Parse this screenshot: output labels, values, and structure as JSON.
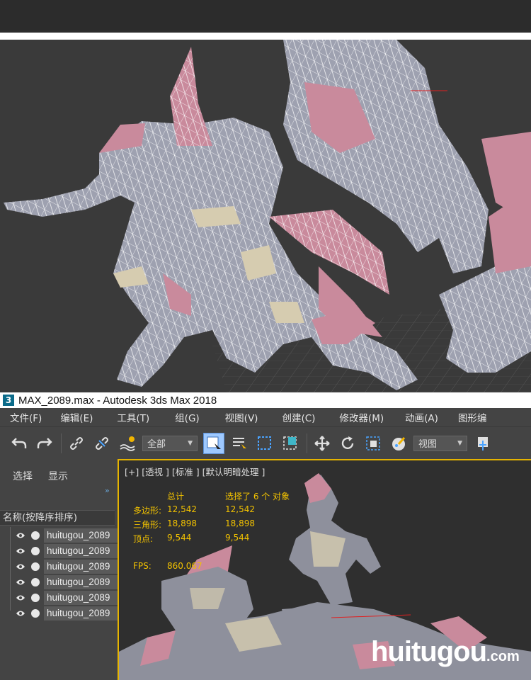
{
  "window": {
    "app_icon": "3",
    "title": "MAX_2089.max - Autodesk 3ds Max 2018"
  },
  "menu": [
    "文件(F)",
    "编辑(E)",
    "工具(T)",
    "组(G)",
    "视图(V)",
    "创建(C)",
    "修改器(M)",
    "动画(A)",
    "图形编"
  ],
  "toolbar": {
    "selection_filter": "全部",
    "reference_coord": "视图"
  },
  "scene_explorer": {
    "tabs": [
      "选择",
      "显示"
    ],
    "collapse": "»",
    "column_header": "名称(按降序排序)",
    "items": [
      "huitugou_2089",
      "huitugou_2089",
      "huitugou_2089",
      "huitugou_2089",
      "huitugou_2089",
      "huitugou_2089"
    ]
  },
  "viewport": {
    "label": "[+] [透视 ] [标准 ] [默认明暗处理 ]",
    "stats": {
      "col_total": "总计",
      "col_selected": "选择了 6 个 对象",
      "poly_label": "多边形:",
      "poly_total": "12,542",
      "poly_selected": "12,542",
      "tri_label": "三角形:",
      "tri_total": "18,898",
      "tri_selected": "18,898",
      "vert_label": "顶点:",
      "vert_total": "9,544",
      "vert_selected": "9,544",
      "fps_label": "FPS:",
      "fps_value": "860.067"
    }
  },
  "watermark": {
    "text": "huitugou",
    "suffix": ".com"
  },
  "colors": {
    "ui_dark": "#444444",
    "viewport_border": "#e6b400",
    "stats_text": "#f2c200",
    "mesh_grey": "#9ea1b0",
    "mesh_pink": "#c98a9c",
    "mesh_bone": "#d6ccb0"
  }
}
